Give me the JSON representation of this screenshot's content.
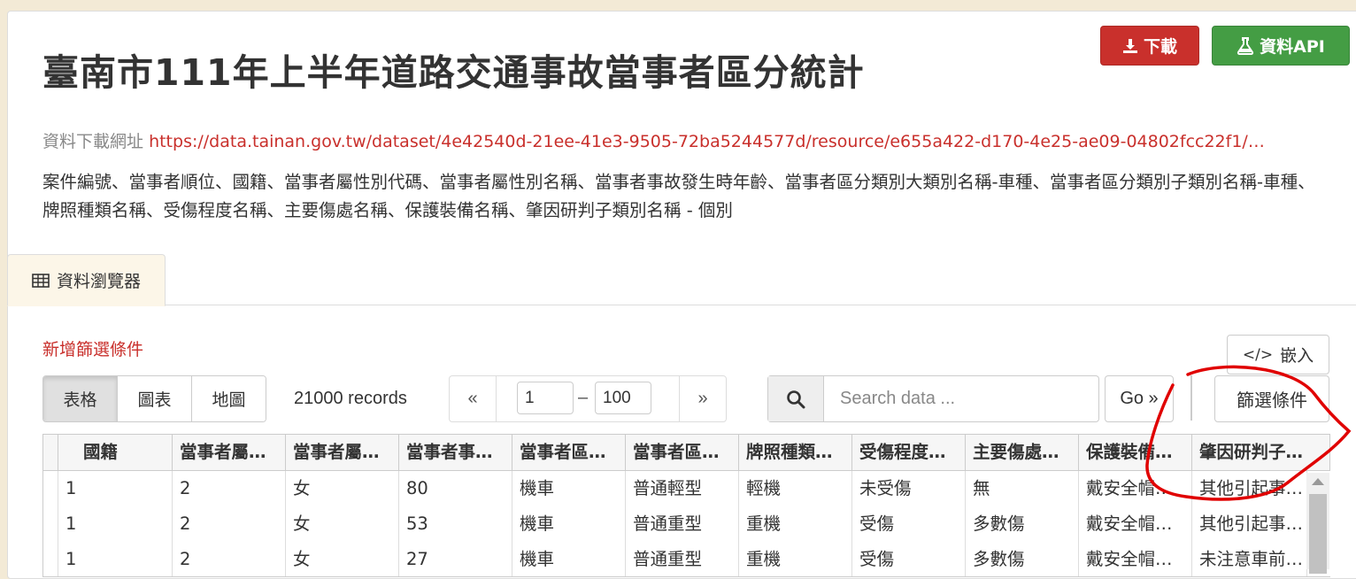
{
  "page": {
    "title": "臺南市111年上半年道路交通事故當事者區分統計",
    "download_label": "下載",
    "api_label": "資料API",
    "download_url_label": "資料下載網址",
    "download_url": "https://data.tainan.gov.tw/dataset/4e42540d-21ee-41e3-9505-72ba5244577d/resource/e655a422-d170-4e25-ae09-04802fcc22f1/…",
    "description": "案件編號、當事者順位、國籍、當事者屬性別代碼、當事者屬性別名稱、當事者事故發生時年齡、當事者區分類別大類別名稱-車種、當事者區分類別子類別名稱-車種、牌照種類名稱、受傷程度名稱、主要傷處名稱、保護裝備名稱、肇因研判子類別名稱 - 個別"
  },
  "tab": {
    "label": "資料瀏覽器",
    "icon": "table-icon"
  },
  "toolbar": {
    "add_filter": "新增篩選條件",
    "embed_label": "嵌入",
    "embed_icon": "code-icon",
    "views": [
      "表格",
      "圖表",
      "地圖"
    ],
    "active_view": "表格",
    "records": "21000 records",
    "pager": {
      "prev": "«",
      "from": "1",
      "dash": "–",
      "to": "100",
      "next": "»"
    },
    "search_placeholder": "Search data ...",
    "go_label": "Go »",
    "filter_label": "篩選條件"
  },
  "grid": {
    "columns": [
      "​",
      "國籍",
      "當事者屬…",
      "當事者屬…",
      "當事者事…",
      "當事者區…",
      "當事者區…",
      "牌照種類…",
      "受傷程度…",
      "主要傷處…",
      "保護裝備…",
      "肇因研判子…"
    ],
    "rows": [
      [
        "",
        "1",
        "2",
        "女",
        "80",
        "機車",
        "普通輕型",
        "輕機",
        "未受傷",
        "無",
        "戴安全帽…",
        "其他引起事…"
      ],
      [
        "",
        "1",
        "2",
        "女",
        "53",
        "機車",
        "普通重型",
        "重機",
        "受傷",
        "多數傷",
        "戴安全帽…",
        "其他引起事…"
      ],
      [
        "",
        "1",
        "2",
        "女",
        "27",
        "機車",
        "普通重型",
        "重機",
        "受傷",
        "多數傷",
        "戴安全帽…",
        "未注意車前…"
      ]
    ]
  },
  "colors": {
    "background": "#f3ead6",
    "accent_red": "#c9302c",
    "accent_green": "#449d44",
    "annotation": "#e00000"
  }
}
